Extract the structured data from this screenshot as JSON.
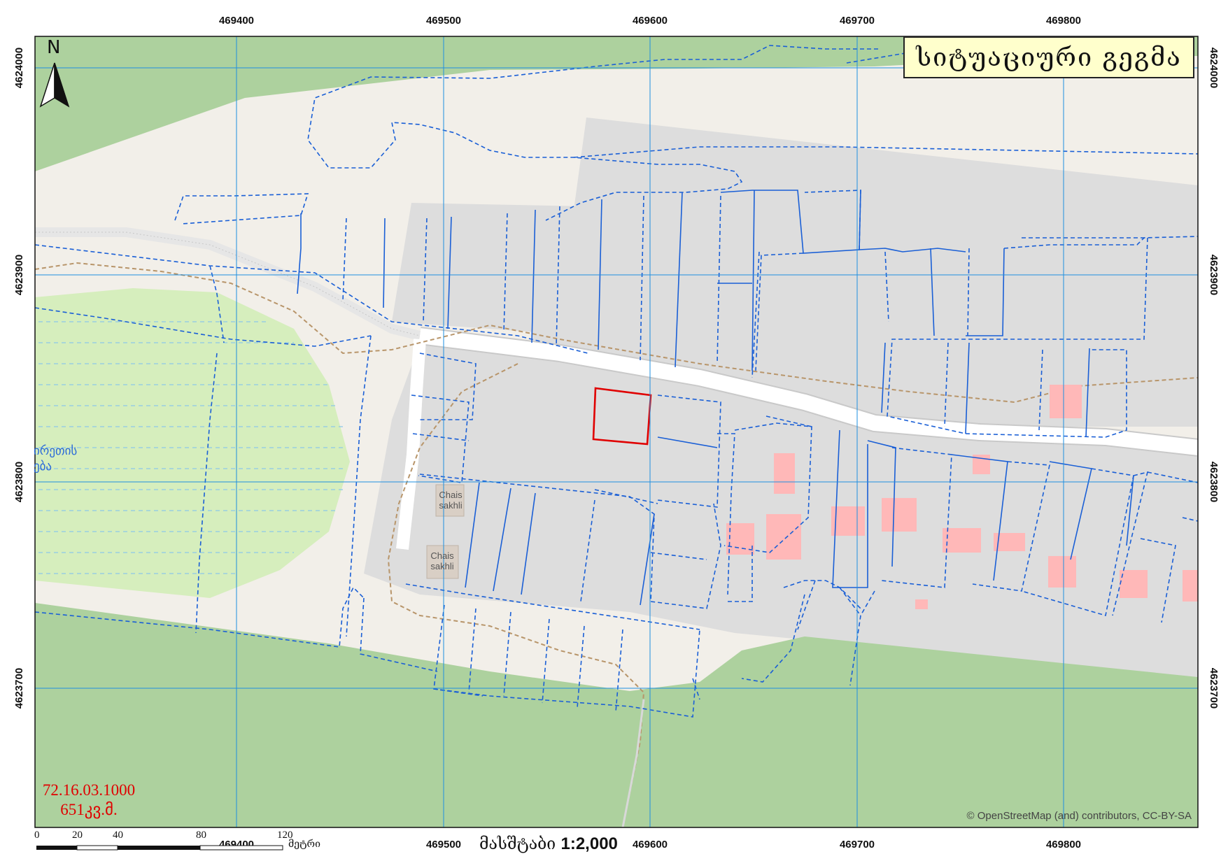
{
  "title": "სიტუაციური გეგმა",
  "parcel": {
    "cadastral_code": "72.16.03.1000",
    "area_label": "651კვ.მ."
  },
  "north_label": "N",
  "grid": {
    "x_labels_top": [
      "469400",
      "469500",
      "469600",
      "469700",
      "469800"
    ],
    "x_labels_bottom": [
      "469400",
      "469500",
      "469600",
      "469700",
      "469800"
    ],
    "y_labels_left": [
      "4624000",
      "4623900",
      "4623800",
      "4623700"
    ],
    "y_labels_right": [
      "4624000",
      "4623900",
      "4623800",
      "4623700"
    ]
  },
  "scale": {
    "label": "მასშტაბი",
    "ratio": "1:2,000",
    "ticks": [
      "0",
      "20",
      "40",
      "80",
      "120"
    ],
    "unit": "მეტრი"
  },
  "attribution": "© OpenStreetMap (and) contributors, CC-BY-SA",
  "map_labels": {
    "lake_line1": "ირეთის",
    "lake_line2": "ება",
    "poi_1": "Chais sakhli",
    "poi_2": "Chais sakhli"
  },
  "colors": {
    "forest": "#add19e",
    "wetland": "#d6eebd",
    "built_area": "#dddddd",
    "background": "#f2efe9",
    "road": "#ffffff",
    "parcel_lines": "#1a5fd6",
    "grid": "#1e8fe0",
    "highlight_parcel": "#e00000",
    "buildings": "#ffb8b8",
    "path": "#b8956a",
    "title_bg": "#ffffcc"
  }
}
